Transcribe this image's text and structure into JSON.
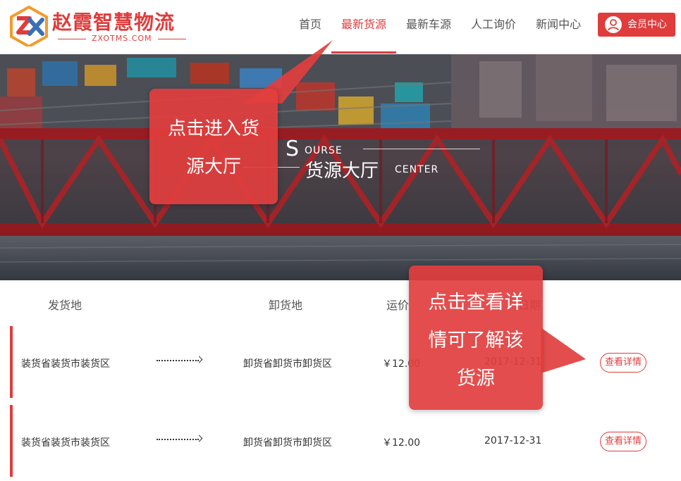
{
  "brand": {
    "name_cn": "赵霞智慧物流",
    "domain": "ZXOTMS.COM",
    "colors": {
      "primary": "#e03c3c",
      "accent_orange": "#f39a2b",
      "accent_blue": "#3a6fb6"
    }
  },
  "nav": {
    "items": [
      {
        "label": "首页"
      },
      {
        "label": "最新货源",
        "active": true
      },
      {
        "label": "最新车源"
      },
      {
        "label": "人工询价"
      },
      {
        "label": "新闻中心"
      }
    ],
    "member_button": "会员中心",
    "member_icon": "user-icon"
  },
  "banner": {
    "title_letter": "S",
    "title_en_rest": "OURSE",
    "title_cn": "货源大厅",
    "title_en_2": "CENTER"
  },
  "table": {
    "headers": {
      "origin": "发货地",
      "destination": "卸货地",
      "price": "运价",
      "date": "日期"
    },
    "rows": [
      {
        "origin": "装货省装货市装货区",
        "destination": "卸货省卸货市卸货区",
        "price": "￥12.00",
        "date": "2017-12-31",
        "action": "查看详情"
      },
      {
        "origin": "装货省装货市装货区",
        "destination": "卸货省卸货市卸货区",
        "price": "￥12.00",
        "date": "2017-12-31",
        "action": "查看详情"
      }
    ]
  },
  "callouts": {
    "banner_tip": [
      "点击进入货",
      "源大厅"
    ],
    "detail_tip": [
      "点击查看详",
      "情可了解该",
      "货源"
    ]
  }
}
